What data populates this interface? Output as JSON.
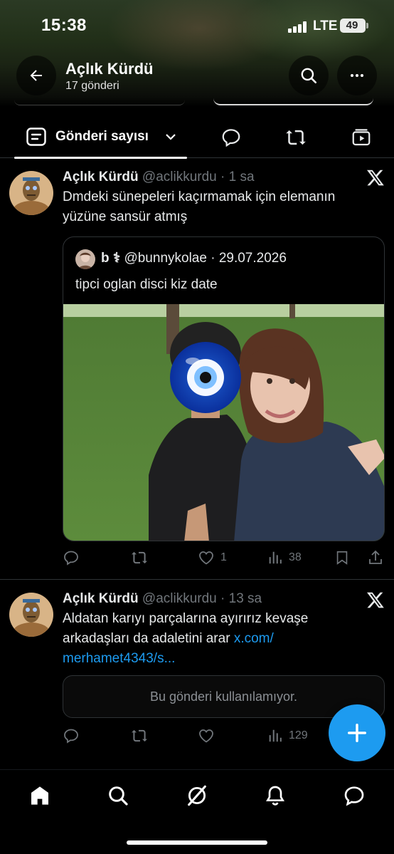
{
  "status_bar": {
    "time": "15:38",
    "network": "LTE",
    "battery": "49"
  },
  "header": {
    "title": "Açlık Kürdü",
    "subtitle": "17 gönderi"
  },
  "tabs": {
    "active_label": "Gönderi sayısı",
    "icons": [
      "bubble-icon",
      "repost-icon",
      "video-icon"
    ]
  },
  "posts": [
    {
      "name": "Açlık Kürdü",
      "handle": "@aclikkurdu",
      "sep": " · ",
      "time": "1 sa",
      "text_line1": "Dmdeki sünepeleri kaçırmamak için elemanın",
      "text_line2": "yüzüne sansür atmış",
      "quote": {
        "name": "b ⚕",
        "handle": "@bunnykolae",
        "sep": " · ",
        "date": "29.07.2026",
        "text": "tipci oglan disci kiz date"
      },
      "actions": {
        "reply": "",
        "repost": "",
        "like": "1",
        "views": "38"
      }
    },
    {
      "name": "Açlık Kürdü",
      "handle": "@aclikkurdu",
      "sep": " · ",
      "time": "13 sa",
      "text_line1": "Aldatan karıyı parçalarına ayırırız kevaşe",
      "text_line2_prefix": "arkadaşları da adaletini arar ",
      "link_part1": "x.com/",
      "link_part2": "merhamet4343/s...",
      "unavailable": "Bu gönderi kullanılamıyor.",
      "actions": {
        "reply": "",
        "repost": "",
        "like": "",
        "views": "129"
      }
    }
  ],
  "colors": {
    "accent": "#1d9bf0",
    "text": "#e7e9ea",
    "muted": "#71767b",
    "border": "#2f3336"
  }
}
